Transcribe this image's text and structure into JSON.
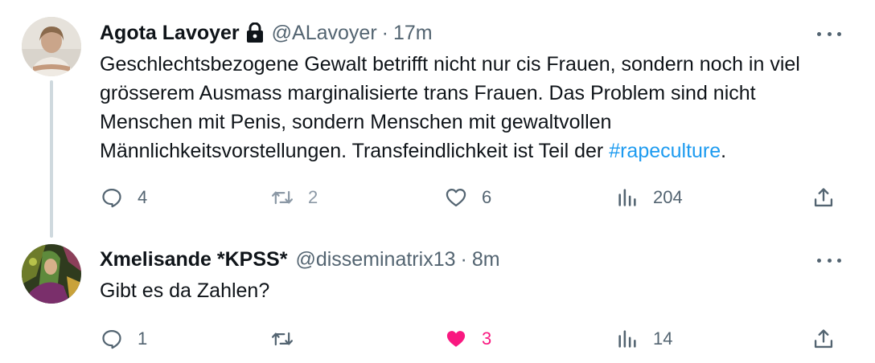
{
  "tweets": [
    {
      "display_name": "Agota Lavoyer",
      "protected": true,
      "handle": "@ALavoyer",
      "separator": "·",
      "time": "17m",
      "text_before": "Geschlechtsbezogene Gewalt betrifft nicht nur cis Frauen, sondern noch in viel grösserem Ausmass marginalisierte trans Frauen. Das Problem sind nicht Menschen mit Penis, sondern Menschen mit gewaltvollen Männlichkeitsvorstellungen. Transfeindlichkeit ist Teil der ",
      "hashtag": "#rapeculture",
      "text_after": ".",
      "replies": "4",
      "retweets": "2",
      "likes": "6",
      "views": "204",
      "liked": false
    },
    {
      "display_name": "Xmelisande *KPSS*",
      "handle": "@disseminatrix13",
      "separator": "·",
      "time": "8m",
      "text_before": "Gibt es da Zahlen?",
      "replies": "1",
      "retweets": "",
      "likes": "3",
      "views": "14",
      "liked": true
    }
  ],
  "colors": {
    "text": "#0f1419",
    "secondary": "#536471",
    "link": "#1d9bf0",
    "like_active": "#f91880",
    "thread_line": "#cfd9de"
  },
  "icons": [
    "lock-icon",
    "more-icon",
    "reply-icon",
    "retweet-icon",
    "heart-icon",
    "views-icon",
    "share-icon"
  ]
}
